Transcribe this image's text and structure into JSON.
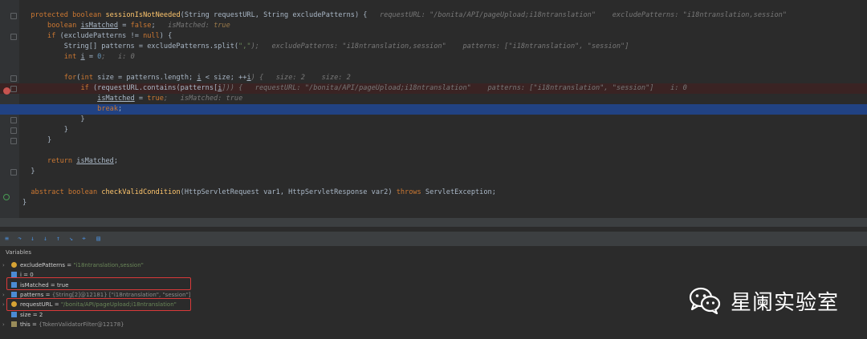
{
  "editor": {
    "lines": [
      {
        "id": "l1",
        "parts": [
          [
            "  ",
            ""
          ],
          [
            "protected boolean ",
            "kw"
          ],
          [
            "sessionIsNotNeeded",
            "fn"
          ],
          [
            "(String requestURL, String excludePatterns) {",
            ""
          ],
          [
            "   requestURL: \"/bonita/API/pageUpload;i18ntranslation\"    excludePatterns: \"i18ntranslation,session\"",
            "hint"
          ]
        ]
      },
      {
        "id": "l2",
        "parts": [
          [
            "      ",
            ""
          ],
          [
            "boolean ",
            "kw"
          ],
          [
            "isMatched",
            "ul"
          ],
          [
            " = ",
            ""
          ],
          [
            "false",
            "kw"
          ],
          [
            ";",
            ""
          ],
          [
            "   isMatched: ",
            "hint"
          ],
          [
            "true",
            "hintkw"
          ]
        ]
      },
      {
        "id": "l3",
        "parts": [
          [
            "      ",
            ""
          ],
          [
            "if ",
            "kw"
          ],
          [
            "(excludePatterns != ",
            ""
          ],
          [
            "null",
            "kw"
          ],
          [
            ") {",
            ""
          ]
        ]
      },
      {
        "id": "l4",
        "parts": [
          [
            "          String[] patterns = excludePatterns.split(",
            ""
          ],
          [
            "\",\"",
            "str"
          ],
          [
            ");   excludePatterns: \"i18ntranslation,session\"    patterns: [\"i18ntranslation\", \"session\"]",
            "hint"
          ]
        ]
      },
      {
        "id": "l5",
        "parts": [
          [
            "          ",
            ""
          ],
          [
            "int ",
            "kw"
          ],
          [
            "i",
            "ul"
          ],
          [
            " = ",
            ""
          ],
          [
            "0",
            "num"
          ],
          [
            ";   i: 0",
            "hint"
          ]
        ]
      },
      {
        "id": "l6",
        "parts": [
          [
            "",
            ""
          ]
        ]
      },
      {
        "id": "l7",
        "parts": [
          [
            "          ",
            ""
          ],
          [
            "for",
            "kw"
          ],
          [
            "(",
            ""
          ],
          [
            "int ",
            "kw"
          ],
          [
            "size = patterns.length; ",
            ""
          ],
          [
            "i",
            "ul"
          ],
          [
            " < size; ++",
            ""
          ],
          [
            "i",
            "ul"
          ],
          [
            ") {   size: 2    size: 2",
            "hint"
          ]
        ]
      },
      {
        "id": "l8",
        "parts": [
          [
            "              ",
            ""
          ],
          [
            "if ",
            "kw"
          ],
          [
            "(requestURL.contains(patterns[",
            ""
          ],
          [
            "i",
            "ul"
          ],
          [
            "])) {   requestURL: \"/bonita/API/pageUpload;i18ntranslation\"    patterns: [\"i18ntranslation\", \"session\"]    i: 0",
            "hint"
          ]
        ]
      },
      {
        "id": "l9",
        "parts": [
          [
            "                  ",
            ""
          ],
          [
            "isMatched",
            "ul"
          ],
          [
            " = ",
            ""
          ],
          [
            "true",
            "kw"
          ],
          [
            ";   isMatched: true",
            "hint"
          ]
        ]
      },
      {
        "id": "l10",
        "parts": [
          [
            "                  ",
            ""
          ],
          [
            "break",
            "kw"
          ],
          [
            ";",
            ""
          ]
        ]
      },
      {
        "id": "l11",
        "parts": [
          [
            "              }",
            ""
          ]
        ]
      },
      {
        "id": "l12",
        "parts": [
          [
            "          }",
            ""
          ]
        ]
      },
      {
        "id": "l13",
        "parts": [
          [
            "      }",
            ""
          ]
        ]
      },
      {
        "id": "l14",
        "parts": [
          [
            "",
            ""
          ]
        ]
      },
      {
        "id": "l15",
        "parts": [
          [
            "      ",
            ""
          ],
          [
            "return ",
            "kw"
          ],
          [
            "isMatched",
            "ul"
          ],
          [
            ";",
            ""
          ]
        ]
      },
      {
        "id": "l16",
        "parts": [
          [
            "  }",
            ""
          ]
        ]
      },
      {
        "id": "l17",
        "parts": [
          [
            "",
            ""
          ]
        ]
      },
      {
        "id": "l18",
        "parts": [
          [
            "  ",
            ""
          ],
          [
            "abstract boolean ",
            "kw"
          ],
          [
            "checkValidCondition",
            "fn"
          ],
          [
            "(HttpServletRequest var1, HttpServletResponse var2) ",
            ""
          ],
          [
            "throws ",
            "kw"
          ],
          [
            "ServletException;",
            ""
          ]
        ]
      },
      {
        "id": "l19",
        "parts": [
          [
            "}",
            ""
          ]
        ]
      }
    ]
  },
  "debugger": {
    "toolbar_icons": [
      "step-over-icon",
      "step-into-icon",
      "force-step-into-icon",
      "step-out-icon",
      "run-to-cursor-icon",
      "evaluate-icon",
      "frames-icon",
      "threads-icon"
    ],
    "variables_label": "Variables",
    "variables": [
      {
        "name": "excludePatterns",
        "eq": " = ",
        "value": "\"i18ntranslation,session\"",
        "icon": "p",
        "expandable": true
      },
      {
        "name": "i",
        "eq": " = ",
        "value": "0",
        "icon": "f",
        "expandable": false
      },
      {
        "name": "isMatched",
        "eq": " = ",
        "value": "true",
        "icon": "f",
        "expandable": false
      },
      {
        "name": "patterns",
        "eq": " = ",
        "value": "{String[2]@12181} [\"i18ntranslation\", \"session\"]",
        "icon": "f",
        "expandable": true
      },
      {
        "name": "requestURL",
        "eq": " = ",
        "value": "\"/bonita/API/pageUpload;i18ntranslation\"",
        "icon": "p",
        "expandable": true
      },
      {
        "name": "size",
        "eq": " = ",
        "value": "2",
        "icon": "f",
        "expandable": false
      },
      {
        "name": "this",
        "eq": " = ",
        "value": "{TokenValidatorFilter@12178}",
        "icon": "l",
        "expandable": true
      }
    ]
  },
  "watermark": {
    "text": "星阑实验室",
    "icon": "wechat-icon"
  },
  "colors": {
    "exec_line": "#214283",
    "breakpoint": "#c75450",
    "highlight_box": "#d93a3a"
  }
}
